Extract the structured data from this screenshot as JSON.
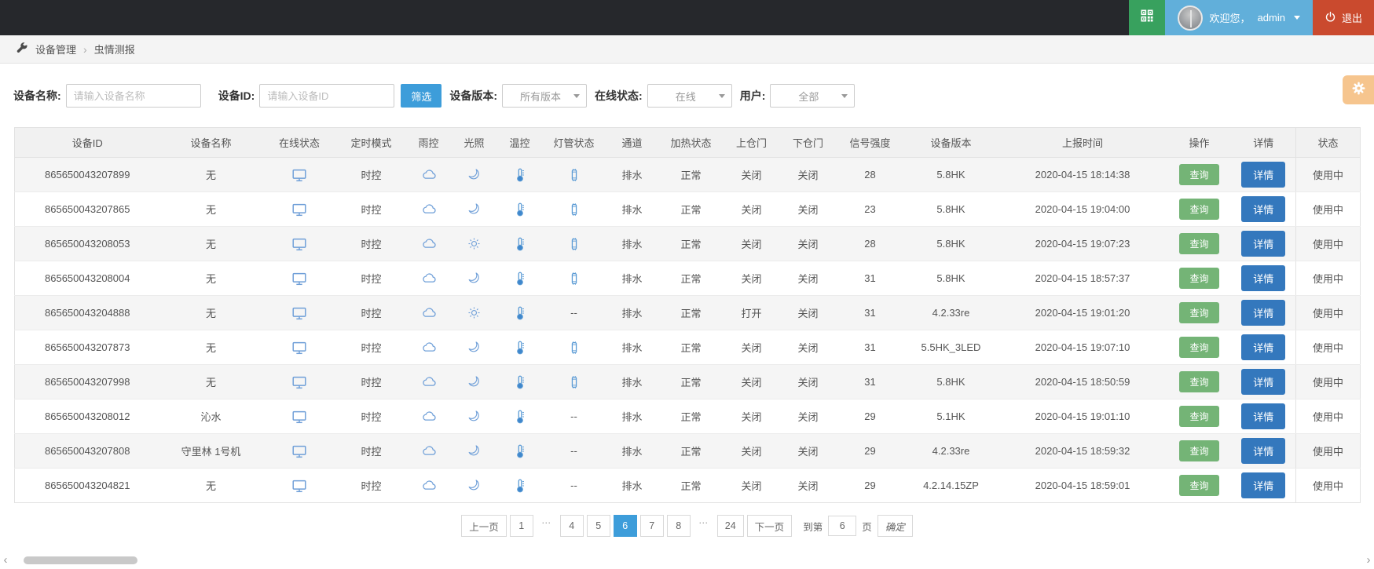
{
  "topbar": {
    "welcome_text": "欢迎您，",
    "username": "admin",
    "logout_label": "退出"
  },
  "breadcrumb": {
    "items": [
      "设备管理",
      "虫情测报"
    ],
    "separator": "›"
  },
  "filters": {
    "device_name_label": "设备名称:",
    "device_name_placeholder": "请输入设备名称",
    "device_id_label": "设备ID:",
    "device_id_placeholder": "请输入设备ID",
    "filter_button": "筛选",
    "version_label": "设备版本:",
    "version_value": "所有版本",
    "online_label": "在线状态:",
    "online_value": "在线",
    "user_label": "用户:",
    "user_value": "全部"
  },
  "table": {
    "columns": [
      "设备ID",
      "设备名称",
      "在线状态",
      "定时模式",
      "雨控",
      "光照",
      "温控",
      "灯管状态",
      "通道",
      "加热状态",
      "上仓门",
      "下仓门",
      "信号强度",
      "设备版本",
      "上报时间",
      "操作",
      "详情",
      "状态"
    ],
    "query_label": "查询",
    "detail_label": "详情",
    "no_value": "--",
    "rows": [
      {
        "device_id": "865650043207899",
        "name": "无",
        "online": "monitor",
        "timer": "时控",
        "rain": "cloud",
        "light": "moon",
        "temp": "thermometer",
        "tube": "tube",
        "channel": "排水",
        "heating": "正常",
        "upper_door": "关闭",
        "lower_door": "关闭",
        "signal": "28",
        "version": "5.8HK",
        "time": "2020-04-15 18:14:38",
        "status": "使用中"
      },
      {
        "device_id": "865650043207865",
        "name": "无",
        "online": "monitor",
        "timer": "时控",
        "rain": "cloud",
        "light": "moon",
        "temp": "thermometer",
        "tube": "tube",
        "channel": "排水",
        "heating": "正常",
        "upper_door": "关闭",
        "lower_door": "关闭",
        "signal": "23",
        "version": "5.8HK",
        "time": "2020-04-15 19:04:00",
        "status": "使用中"
      },
      {
        "device_id": "865650043208053",
        "name": "无",
        "online": "monitor",
        "timer": "时控",
        "rain": "cloud",
        "light": "sun",
        "temp": "thermometer",
        "tube": "tube",
        "channel": "排水",
        "heating": "正常",
        "upper_door": "关闭",
        "lower_door": "关闭",
        "signal": "28",
        "version": "5.8HK",
        "time": "2020-04-15 19:07:23",
        "status": "使用中"
      },
      {
        "device_id": "865650043208004",
        "name": "无",
        "online": "monitor",
        "timer": "时控",
        "rain": "cloud",
        "light": "moon",
        "temp": "thermometer",
        "tube": "tube",
        "channel": "排水",
        "heating": "正常",
        "upper_door": "关闭",
        "lower_door": "关闭",
        "signal": "31",
        "version": "5.8HK",
        "time": "2020-04-15 18:57:37",
        "status": "使用中"
      },
      {
        "device_id": "865650043204888",
        "name": "无",
        "online": "monitor",
        "timer": "时控",
        "rain": "cloud",
        "light": "sun",
        "temp": "thermometer",
        "tube": "--",
        "channel": "排水",
        "heating": "正常",
        "upper_door": "打开",
        "lower_door": "关闭",
        "signal": "31",
        "version": "4.2.33re",
        "time": "2020-04-15 19:01:20",
        "status": "使用中"
      },
      {
        "device_id": "865650043207873",
        "name": "无",
        "online": "monitor",
        "timer": "时控",
        "rain": "cloud",
        "light": "moon",
        "temp": "thermometer",
        "tube": "tube",
        "channel": "排水",
        "heating": "正常",
        "upper_door": "关闭",
        "lower_door": "关闭",
        "signal": "31",
        "version": "5.5HK_3LED",
        "time": "2020-04-15 19:07:10",
        "status": "使用中"
      },
      {
        "device_id": "865650043207998",
        "name": "无",
        "online": "monitor",
        "timer": "时控",
        "rain": "cloud",
        "light": "moon",
        "temp": "thermometer",
        "tube": "tube",
        "channel": "排水",
        "heating": "正常",
        "upper_door": "关闭",
        "lower_door": "关闭",
        "signal": "31",
        "version": "5.8HK",
        "time": "2020-04-15 18:50:59",
        "status": "使用中"
      },
      {
        "device_id": "865650043208012",
        "name": "沁水",
        "online": "monitor",
        "timer": "时控",
        "rain": "cloud",
        "light": "moon",
        "temp": "thermometer",
        "tube": "--",
        "channel": "排水",
        "heating": "正常",
        "upper_door": "关闭",
        "lower_door": "关闭",
        "signal": "29",
        "version": "5.1HK",
        "time": "2020-04-15 19:01:10",
        "status": "使用中"
      },
      {
        "device_id": "865650043207808",
        "name": "守里林 1号机",
        "online": "monitor",
        "timer": "时控",
        "rain": "cloud",
        "light": "moon",
        "temp": "thermometer",
        "tube": "--",
        "channel": "排水",
        "heating": "正常",
        "upper_door": "关闭",
        "lower_door": "关闭",
        "signal": "29",
        "version": "4.2.33re",
        "time": "2020-04-15 18:59:32",
        "status": "使用中"
      },
      {
        "device_id": "865650043204821",
        "name": "无",
        "online": "monitor",
        "timer": "时控",
        "rain": "cloud",
        "light": "moon",
        "temp": "thermometer",
        "tube": "--",
        "channel": "排水",
        "heating": "正常",
        "upper_door": "关闭",
        "lower_door": "关闭",
        "signal": "29",
        "version": "4.2.14.15ZP",
        "time": "2020-04-15 18:59:01",
        "status": "使用中"
      }
    ]
  },
  "pagination": {
    "prev": "上一页",
    "next": "下一页",
    "pages": [
      "1",
      "…",
      "4",
      "5",
      "6",
      "7",
      "8",
      "…",
      "24"
    ],
    "active_page": "6",
    "goto_prefix": "到第",
    "goto_value": "6",
    "goto_suffix": "页",
    "confirm": "确定"
  },
  "icons": {
    "topbar": [
      "qr-code-icon",
      "power-icon",
      "caret-down-icon"
    ],
    "breadcrumb": [
      "wrench-icon"
    ],
    "table": [
      "monitor-icon",
      "cloud-icon",
      "moon-icon",
      "sun-icon",
      "thermometer-icon",
      "lamp-tube-icon"
    ],
    "misc": [
      "gear-icon",
      "chevron-left-icon",
      "chevron-right-icon"
    ]
  },
  "colors": {
    "topbar_bg": "#26282c",
    "qr_green": "#38a15e",
    "user_blue": "#61afda",
    "logout_red": "#ca4a2e",
    "filter_blue": "#3d9dda",
    "query_green": "#74b476",
    "detail_blue": "#3478bd",
    "active_page_blue": "#3d9dda",
    "fab_orange": "#f6c58e",
    "icon_blue": "#6f9fd8",
    "stripe_gray": "#f5f5f5"
  }
}
